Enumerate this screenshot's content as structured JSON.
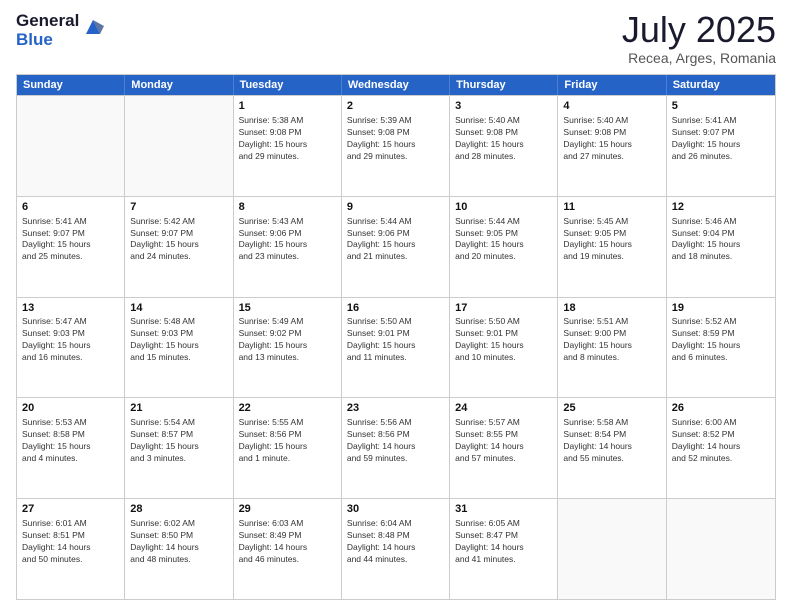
{
  "logo": {
    "general": "General",
    "blue": "Blue"
  },
  "title": "July 2025",
  "location": "Recea, Arges, Romania",
  "weekdays": [
    "Sunday",
    "Monday",
    "Tuesday",
    "Wednesday",
    "Thursday",
    "Friday",
    "Saturday"
  ],
  "rows": [
    [
      {
        "day": "",
        "info": ""
      },
      {
        "day": "",
        "info": ""
      },
      {
        "day": "1",
        "info": "Sunrise: 5:38 AM\nSunset: 9:08 PM\nDaylight: 15 hours\nand 29 minutes."
      },
      {
        "day": "2",
        "info": "Sunrise: 5:39 AM\nSunset: 9:08 PM\nDaylight: 15 hours\nand 29 minutes."
      },
      {
        "day": "3",
        "info": "Sunrise: 5:40 AM\nSunset: 9:08 PM\nDaylight: 15 hours\nand 28 minutes."
      },
      {
        "day": "4",
        "info": "Sunrise: 5:40 AM\nSunset: 9:08 PM\nDaylight: 15 hours\nand 27 minutes."
      },
      {
        "day": "5",
        "info": "Sunrise: 5:41 AM\nSunset: 9:07 PM\nDaylight: 15 hours\nand 26 minutes."
      }
    ],
    [
      {
        "day": "6",
        "info": "Sunrise: 5:41 AM\nSunset: 9:07 PM\nDaylight: 15 hours\nand 25 minutes."
      },
      {
        "day": "7",
        "info": "Sunrise: 5:42 AM\nSunset: 9:07 PM\nDaylight: 15 hours\nand 24 minutes."
      },
      {
        "day": "8",
        "info": "Sunrise: 5:43 AM\nSunset: 9:06 PM\nDaylight: 15 hours\nand 23 minutes."
      },
      {
        "day": "9",
        "info": "Sunrise: 5:44 AM\nSunset: 9:06 PM\nDaylight: 15 hours\nand 21 minutes."
      },
      {
        "day": "10",
        "info": "Sunrise: 5:44 AM\nSunset: 9:05 PM\nDaylight: 15 hours\nand 20 minutes."
      },
      {
        "day": "11",
        "info": "Sunrise: 5:45 AM\nSunset: 9:05 PM\nDaylight: 15 hours\nand 19 minutes."
      },
      {
        "day": "12",
        "info": "Sunrise: 5:46 AM\nSunset: 9:04 PM\nDaylight: 15 hours\nand 18 minutes."
      }
    ],
    [
      {
        "day": "13",
        "info": "Sunrise: 5:47 AM\nSunset: 9:03 PM\nDaylight: 15 hours\nand 16 minutes."
      },
      {
        "day": "14",
        "info": "Sunrise: 5:48 AM\nSunset: 9:03 PM\nDaylight: 15 hours\nand 15 minutes."
      },
      {
        "day": "15",
        "info": "Sunrise: 5:49 AM\nSunset: 9:02 PM\nDaylight: 15 hours\nand 13 minutes."
      },
      {
        "day": "16",
        "info": "Sunrise: 5:50 AM\nSunset: 9:01 PM\nDaylight: 15 hours\nand 11 minutes."
      },
      {
        "day": "17",
        "info": "Sunrise: 5:50 AM\nSunset: 9:01 PM\nDaylight: 15 hours\nand 10 minutes."
      },
      {
        "day": "18",
        "info": "Sunrise: 5:51 AM\nSunset: 9:00 PM\nDaylight: 15 hours\nand 8 minutes."
      },
      {
        "day": "19",
        "info": "Sunrise: 5:52 AM\nSunset: 8:59 PM\nDaylight: 15 hours\nand 6 minutes."
      }
    ],
    [
      {
        "day": "20",
        "info": "Sunrise: 5:53 AM\nSunset: 8:58 PM\nDaylight: 15 hours\nand 4 minutes."
      },
      {
        "day": "21",
        "info": "Sunrise: 5:54 AM\nSunset: 8:57 PM\nDaylight: 15 hours\nand 3 minutes."
      },
      {
        "day": "22",
        "info": "Sunrise: 5:55 AM\nSunset: 8:56 PM\nDaylight: 15 hours\nand 1 minute."
      },
      {
        "day": "23",
        "info": "Sunrise: 5:56 AM\nSunset: 8:56 PM\nDaylight: 14 hours\nand 59 minutes."
      },
      {
        "day": "24",
        "info": "Sunrise: 5:57 AM\nSunset: 8:55 PM\nDaylight: 14 hours\nand 57 minutes."
      },
      {
        "day": "25",
        "info": "Sunrise: 5:58 AM\nSunset: 8:54 PM\nDaylight: 14 hours\nand 55 minutes."
      },
      {
        "day": "26",
        "info": "Sunrise: 6:00 AM\nSunset: 8:52 PM\nDaylight: 14 hours\nand 52 minutes."
      }
    ],
    [
      {
        "day": "27",
        "info": "Sunrise: 6:01 AM\nSunset: 8:51 PM\nDaylight: 14 hours\nand 50 minutes."
      },
      {
        "day": "28",
        "info": "Sunrise: 6:02 AM\nSunset: 8:50 PM\nDaylight: 14 hours\nand 48 minutes."
      },
      {
        "day": "29",
        "info": "Sunrise: 6:03 AM\nSunset: 8:49 PM\nDaylight: 14 hours\nand 46 minutes."
      },
      {
        "day": "30",
        "info": "Sunrise: 6:04 AM\nSunset: 8:48 PM\nDaylight: 14 hours\nand 44 minutes."
      },
      {
        "day": "31",
        "info": "Sunrise: 6:05 AM\nSunset: 8:47 PM\nDaylight: 14 hours\nand 41 minutes."
      },
      {
        "day": "",
        "info": ""
      },
      {
        "day": "",
        "info": ""
      }
    ]
  ]
}
